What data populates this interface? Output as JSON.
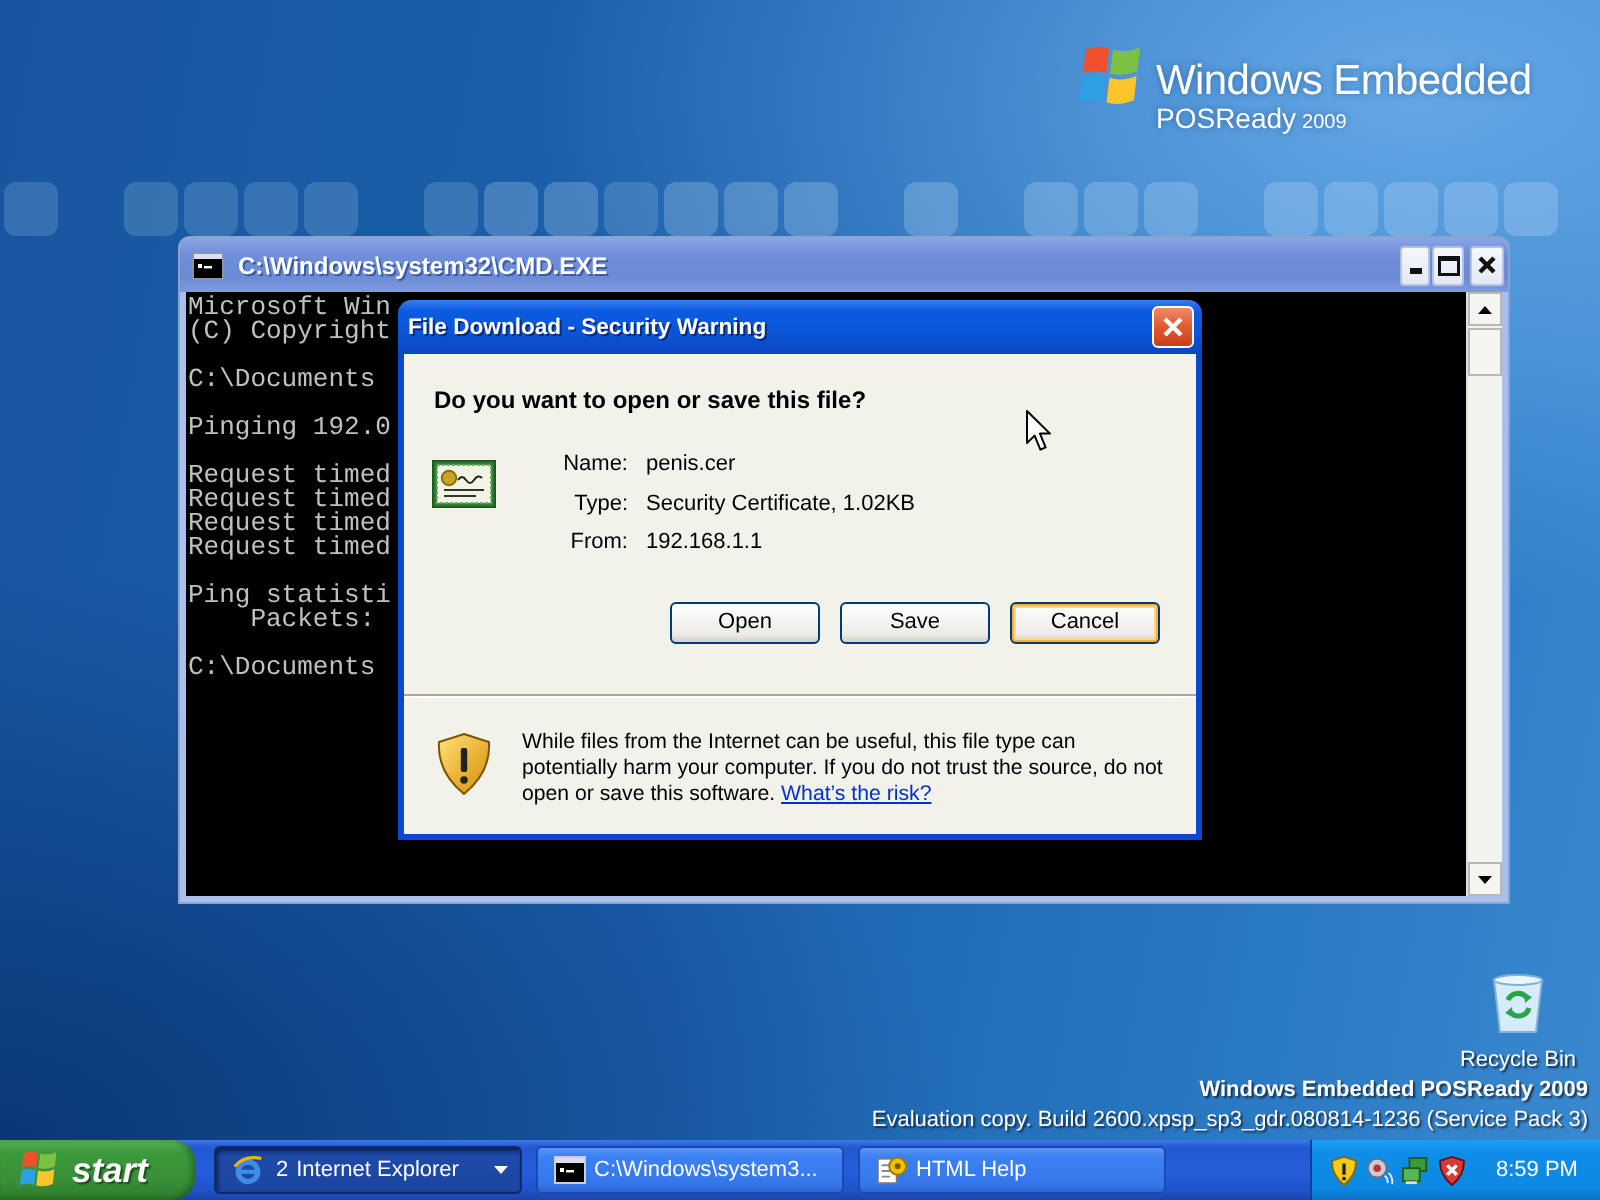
{
  "desktop": {
    "logo": {
      "title": "Windows Embedded",
      "subtitle": "POSReady",
      "year": "2009"
    },
    "icons": [
      {
        "label": "Recycle Bin"
      }
    ],
    "build_info": {
      "product": "Windows Embedded POSReady 2009",
      "build": "Evaluation copy. Build 2600.xpsp_sp3_gdr.080814-1236 (Service Pack 3)"
    }
  },
  "console_window": {
    "title": "C:\\Windows\\system32\\CMD.EXE",
    "active": false,
    "output": [
      [
        "Microsoft Win",
        "(C) Copyright"
      ],
      [
        "C:\\Documents"
      ],
      [
        "Pinging 192.0"
      ],
      [
        "Request timed",
        "Request timed",
        "Request timed",
        "Request timed"
      ],
      [
        "Ping statisti",
        "    Packets:"
      ],
      [
        "C:\\Documents"
      ]
    ]
  },
  "dialog": {
    "title": "File Download - Security Warning",
    "active": true,
    "question": "Do you want to open or save this file?",
    "details": [
      {
        "label": "Name:",
        "value": "penis.cer"
      },
      {
        "label": "Type:",
        "value": "Security Certificate, 1.02KB"
      },
      {
        "label": "From:",
        "value": "192.168.1.1"
      }
    ],
    "buttons": [
      {
        "label": "Open",
        "focused": false
      },
      {
        "label": "Save",
        "focused": false
      },
      {
        "label": "Cancel",
        "focused": true
      }
    ],
    "warning": {
      "text": "While files from the Internet can be useful, this file type can potentially harm your computer. If you do not trust the source, do not open or save this software.",
      "link": "What’s the risk?"
    }
  },
  "taskbar": {
    "start": "start",
    "tasks": [
      {
        "count": "2",
        "label": "Internet Explorer",
        "selected": true
      },
      {
        "label": "C:\\Windows\\system3...",
        "selected": false
      },
      {
        "label": "HTML Help",
        "selected": false
      }
    ],
    "clock": "8:59 PM"
  }
}
